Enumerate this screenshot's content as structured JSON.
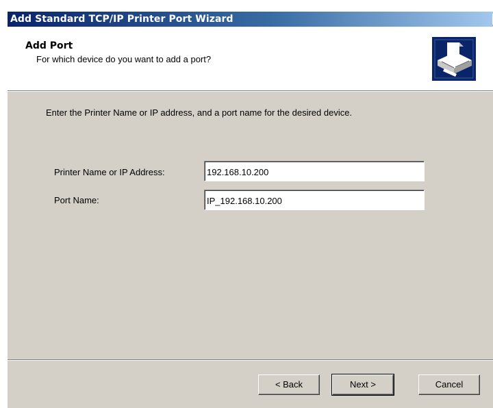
{
  "window": {
    "title": "Add Standard TCP/IP Printer Port Wizard",
    "close_glyph": "✕"
  },
  "header": {
    "title": "Add Port",
    "subtitle": "For which device do you want to add a port?",
    "icon": "printer-icon"
  },
  "body": {
    "instruction": "Enter the Printer Name or IP address, and a port name for the desired device.",
    "fields": [
      {
        "label": "Printer Name or IP Address:",
        "value": "192.168.10.200"
      },
      {
        "label": "Port Name:",
        "value": "IP_192.168.10.200"
      }
    ]
  },
  "buttons": {
    "back": "< Back",
    "next": "Next >",
    "cancel": "Cancel"
  },
  "colors": {
    "titlebar_start": "#0a246a",
    "titlebar_end": "#a6caf0",
    "dialog_bg": "#d4d0c8",
    "icon_bg": "#0a246a"
  }
}
